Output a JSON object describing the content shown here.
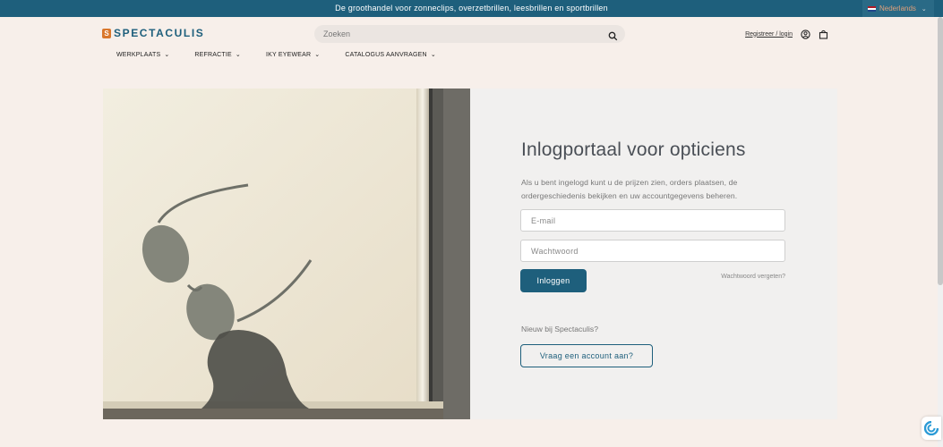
{
  "topbar": {
    "message": "De groothandel voor zonneclips, overzetbrillen, leesbrillen en sportbrillen",
    "language": "Nederlands"
  },
  "header": {
    "logo_mark": "S",
    "logo_text": "SPECTACULIS",
    "search_placeholder": "Zoeken",
    "account_link": "Registreer / login"
  },
  "nav": {
    "items": [
      {
        "label": "WERKPLAATS"
      },
      {
        "label": "REFRACTIE"
      },
      {
        "label": "IKY EYEWEAR"
      },
      {
        "label": "CATALOGUS AANVRAGEN"
      }
    ]
  },
  "login": {
    "title": "Inlogportaal voor opticiens",
    "intro": "Als u bent ingelogd kunt u de prijzen zien, orders plaatsen, de ordergeschiedenis bekijken en uw accountgegevens beheren.",
    "email_placeholder": "E-mail",
    "password_placeholder": "Wachtwoord",
    "login_button": "Inloggen",
    "forgot_link": "Wachtwoord vergeten?",
    "new_label": "Nieuw bij Spectaculis?",
    "request_button": "Vraag een account aan?"
  },
  "colors": {
    "brand": "#1e5f7c",
    "logo_accent": "#d9772c",
    "page_bg": "#f7efea",
    "panel_bg": "#f1f0ef"
  },
  "icons": {
    "search": "search-icon",
    "account": "user-circle-icon",
    "cart": "shopping-bag-icon",
    "flag": "netherlands-flag-icon",
    "widget": "chat-widget-icon"
  }
}
